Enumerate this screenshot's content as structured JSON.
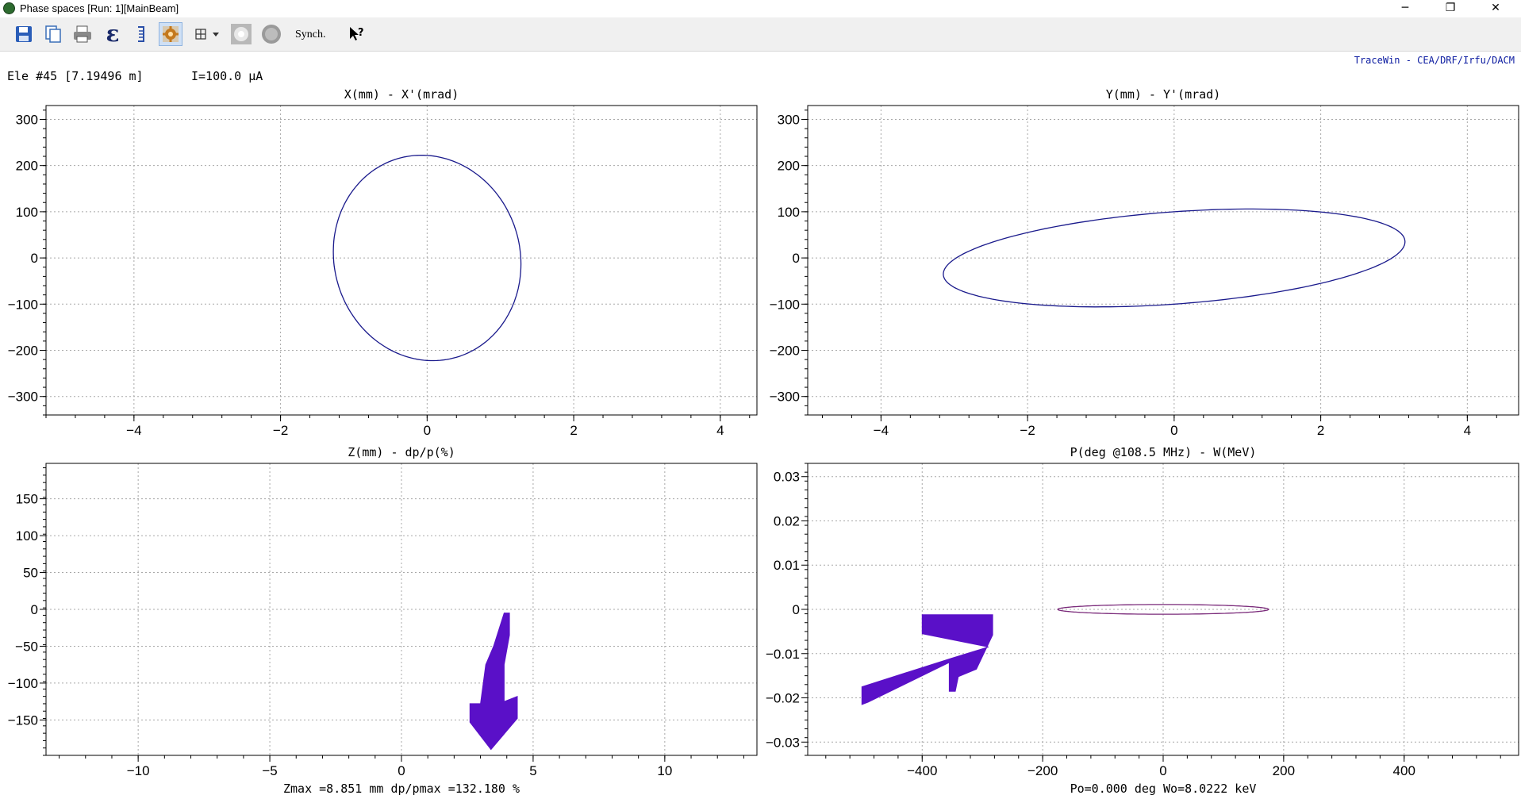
{
  "window": {
    "title": "Phase spaces [Run: 1][MainBeam]",
    "minimize_glyph": "─",
    "restore_glyph": "❐",
    "close_glyph": "✕"
  },
  "toolbar": {
    "items": [
      {
        "name": "save-icon"
      },
      {
        "name": "copy-icon"
      },
      {
        "name": "print-icon"
      },
      {
        "name": "epsilon-icon",
        "glyph": "ε"
      },
      {
        "name": "bracket-icon"
      },
      {
        "name": "settings-icon"
      },
      {
        "name": "grid-icon"
      },
      {
        "name": "halo-icon"
      },
      {
        "name": "circle-icon"
      }
    ],
    "synch_label": "Synch.",
    "help_glyph": "?"
  },
  "header": {
    "element": "Ele #45 [7.19496 m]",
    "current": "I=100.0 µA",
    "credit": "TraceWin - CEA/DRF/Irfu/DACM"
  },
  "colors": {
    "ellipse": "#1a1a8c",
    "ellipse_w": "#7a2a7a",
    "particles": "#5a10c8",
    "grid": "#a8a8a8"
  },
  "chart_data": [
    {
      "type": "scatter",
      "title": "X(mm) - X'(mrad)",
      "xlim": [
        -5.2,
        4.5
      ],
      "ylim": [
        -340,
        330
      ],
      "xticks": [
        -4,
        -2,
        0,
        2,
        4
      ],
      "yticks": [
        300,
        200,
        100,
        0,
        -100,
        -200,
        -300
      ],
      "grid": true,
      "ellipse": {
        "cx": 0,
        "cy": 0,
        "a": 1.28,
        "b": 222,
        "tilt": -0.06
      },
      "footer": ""
    },
    {
      "type": "scatter",
      "title": "Y(mm) - Y'(mrad)",
      "xlim": [
        -5.0,
        4.7
      ],
      "ylim": [
        -340,
        330
      ],
      "xticks": [
        -4,
        -2,
        0,
        2,
        4
      ],
      "yticks": [
        300,
        200,
        100,
        0,
        -100,
        -200,
        -300
      ],
      "grid": true,
      "ellipse": {
        "cx": 0,
        "cy": 0,
        "a": 3.15,
        "b": 100,
        "tilt": 0.35
      },
      "footer": ""
    },
    {
      "type": "scatter",
      "title": "Z(mm) - dp/p(%)",
      "xlim": [
        -13.5,
        13.5
      ],
      "ylim": [
        -198,
        198
      ],
      "xticks": [
        -10,
        -5,
        0,
        5,
        10
      ],
      "yticks": [
        150,
        100,
        50,
        0,
        -50,
        -100,
        -150
      ],
      "grid": true,
      "particles": {
        "shape": "down-arrow",
        "points": [
          [
            4.1,
            -5
          ],
          [
            4.1,
            -35
          ],
          [
            3.9,
            -75
          ],
          [
            3.9,
            -125
          ],
          [
            4.4,
            -118
          ],
          [
            4.4,
            -148
          ],
          [
            3.4,
            -190
          ],
          [
            2.6,
            -153
          ],
          [
            2.6,
            -128
          ],
          [
            3.0,
            -128
          ],
          [
            3.2,
            -75
          ],
          [
            3.5,
            -50
          ],
          [
            3.9,
            -5
          ]
        ]
      },
      "footer": "Zmax =8.851 mm  dp/pmax =132.180 %"
    },
    {
      "type": "scatter",
      "title": "P(deg @108.5 MHz) - W(MeV)",
      "xlim": [
        -590,
        590
      ],
      "ylim": [
        -0.033,
        0.033
      ],
      "xticks": [
        -400,
        -200,
        0,
        200,
        400
      ],
      "yticks": [
        0.03,
        0.02,
        0.01,
        0,
        -0.01,
        -0.02,
        -0.03
      ],
      "ytick_labels": [
        "0.03",
        "0.02",
        "0.01",
        "0",
        "-0.01",
        "-0.02",
        "-0.03"
      ],
      "grid": true,
      "ellipse": {
        "cx": 0,
        "cy": 0,
        "a": 175,
        "b": 0.0011,
        "tilt": 0
      },
      "particles": {
        "shape": "up-right-arrow",
        "points": [
          [
            -500,
            -0.0215
          ],
          [
            -500,
            -0.0175
          ],
          [
            -350,
            -0.011
          ],
          [
            -290,
            -0.0085
          ],
          [
            -400,
            -0.0055
          ],
          [
            -400,
            -0.0012
          ],
          [
            -283,
            -0.0012
          ],
          [
            -283,
            -0.0058
          ],
          [
            -310,
            -0.0135
          ],
          [
            -340,
            -0.0152
          ],
          [
            -345,
            -0.0185
          ],
          [
            -355,
            -0.0185
          ],
          [
            -355,
            -0.012
          ],
          [
            -490,
            -0.021
          ]
        ]
      },
      "footer": "Po=0.000 deg  Wo=8.0222 keV"
    }
  ]
}
